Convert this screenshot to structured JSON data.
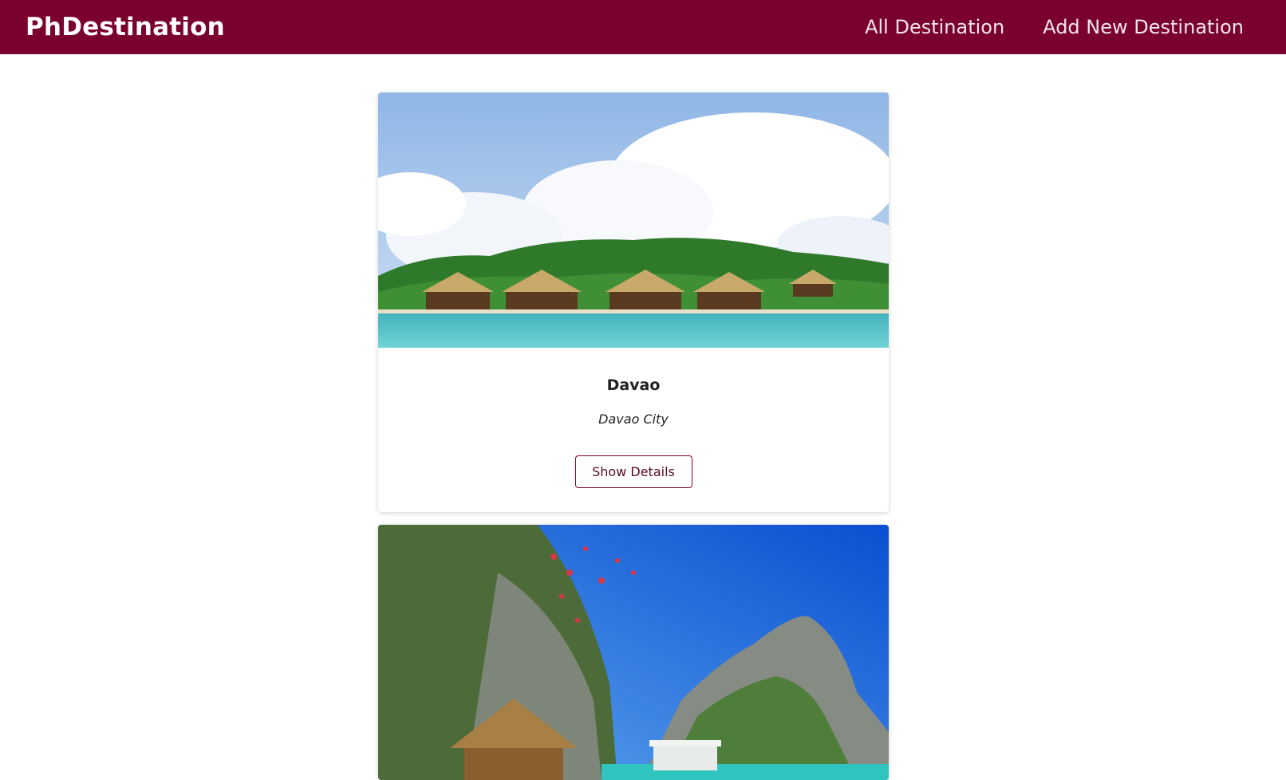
{
  "navbar": {
    "brand": "PhDestination",
    "links": [
      "All Destination",
      "Add New Destination"
    ]
  },
  "destinations": [
    {
      "name": "Davao",
      "location": "Davao City",
      "button_label": "Show Details",
      "image": "beach-resort-photo"
    },
    {
      "image": "island-lagoon-photo"
    }
  ],
  "colors": {
    "brand": "#7a002e"
  }
}
